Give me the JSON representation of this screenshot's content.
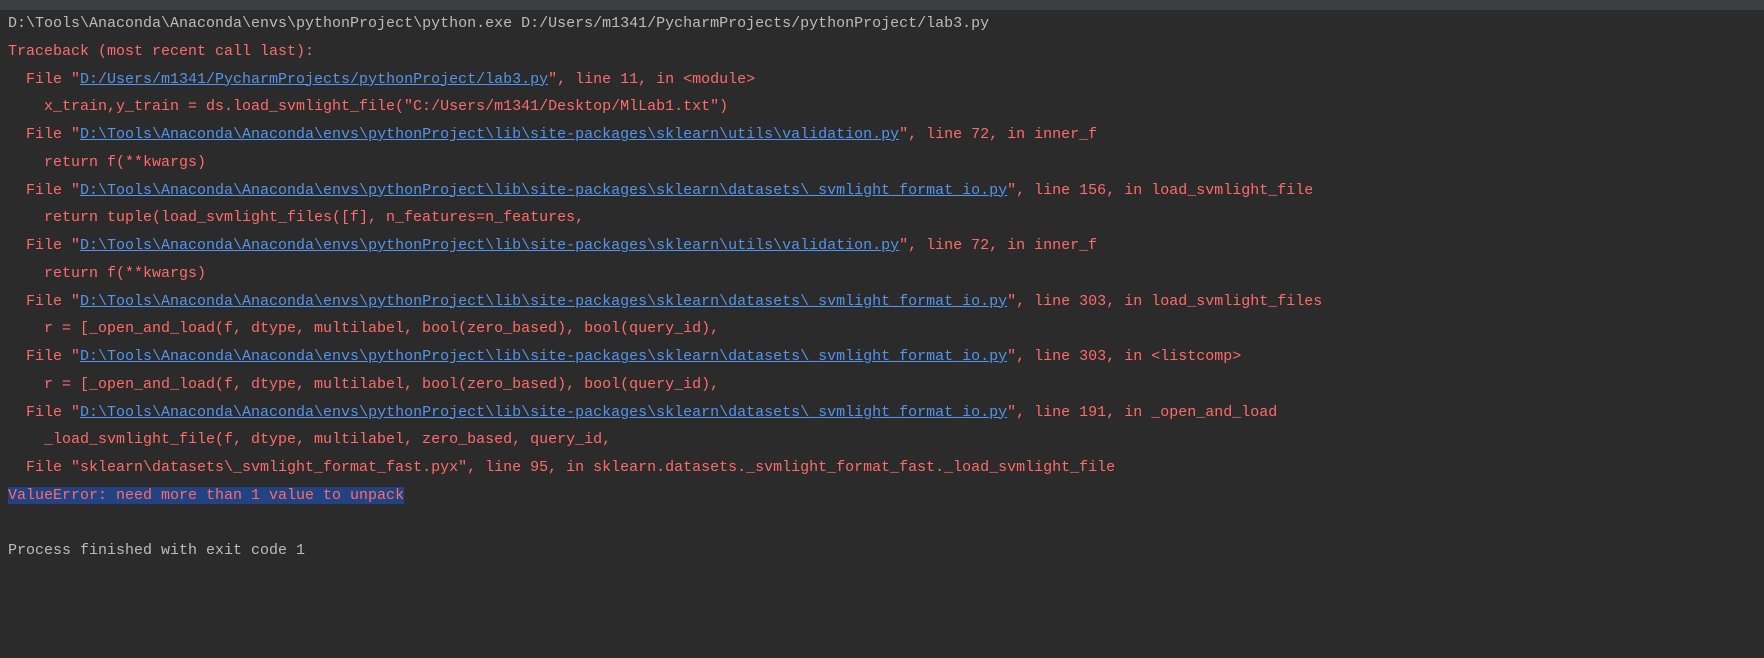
{
  "command": "D:\\Tools\\Anaconda\\Anaconda\\envs\\pythonProject\\python.exe D:/Users/m1341/PycharmProjects/pythonProject/lab3.py",
  "traceback_header": "Traceback (most recent call last):",
  "frames": [
    {
      "file_prefix": "File \"",
      "path": "D:/Users/m1341/PycharmProjects/pythonProject/lab3.py",
      "suffix": "\", line 11, in <module>",
      "code": "x_train,y_train = ds.load_svmlight_file(\"C:/Users/m1341/Desktop/MlLab1.txt\")"
    },
    {
      "file_prefix": "File \"",
      "path": "D:\\Tools\\Anaconda\\Anaconda\\envs\\pythonProject\\lib\\site-packages\\sklearn\\utils\\validation.py",
      "suffix": "\", line 72, in inner_f",
      "code": "return f(**kwargs)"
    },
    {
      "file_prefix": "File \"",
      "path": "D:\\Tools\\Anaconda\\Anaconda\\envs\\pythonProject\\lib\\site-packages\\sklearn\\datasets\\_svmlight_format_io.py",
      "suffix": "\", line 156, in load_svmlight_file",
      "code": "return tuple(load_svmlight_files([f], n_features=n_features,"
    },
    {
      "file_prefix": "File \"",
      "path": "D:\\Tools\\Anaconda\\Anaconda\\envs\\pythonProject\\lib\\site-packages\\sklearn\\utils\\validation.py",
      "suffix": "\", line 72, in inner_f",
      "code": "return f(**kwargs)"
    },
    {
      "file_prefix": "File \"",
      "path": "D:\\Tools\\Anaconda\\Anaconda\\envs\\pythonProject\\lib\\site-packages\\sklearn\\datasets\\_svmlight_format_io.py",
      "suffix": "\", line 303, in load_svmlight_files",
      "code": "r = [_open_and_load(f, dtype, multilabel, bool(zero_based), bool(query_id),"
    },
    {
      "file_prefix": "File \"",
      "path": "D:\\Tools\\Anaconda\\Anaconda\\envs\\pythonProject\\lib\\site-packages\\sklearn\\datasets\\_svmlight_format_io.py",
      "suffix": "\", line 303, in <listcomp>",
      "code": "r = [_open_and_load(f, dtype, multilabel, bool(zero_based), bool(query_id),"
    },
    {
      "file_prefix": "File \"",
      "path": "D:\\Tools\\Anaconda\\Anaconda\\envs\\pythonProject\\lib\\site-packages\\sklearn\\datasets\\_svmlight_format_io.py",
      "suffix": "\", line 191, in _open_and_load",
      "code": "_load_svmlight_file(f, dtype, multilabel, zero_based, query_id,"
    }
  ],
  "last_frame": "File \"sklearn\\datasets\\_svmlight_format_fast.pyx\", line 95, in sklearn.datasets._svmlight_format_fast._load_svmlight_file",
  "error_message": "ValueError: need more than 1 value to unpack",
  "exit_message": "Process finished with exit code 1"
}
